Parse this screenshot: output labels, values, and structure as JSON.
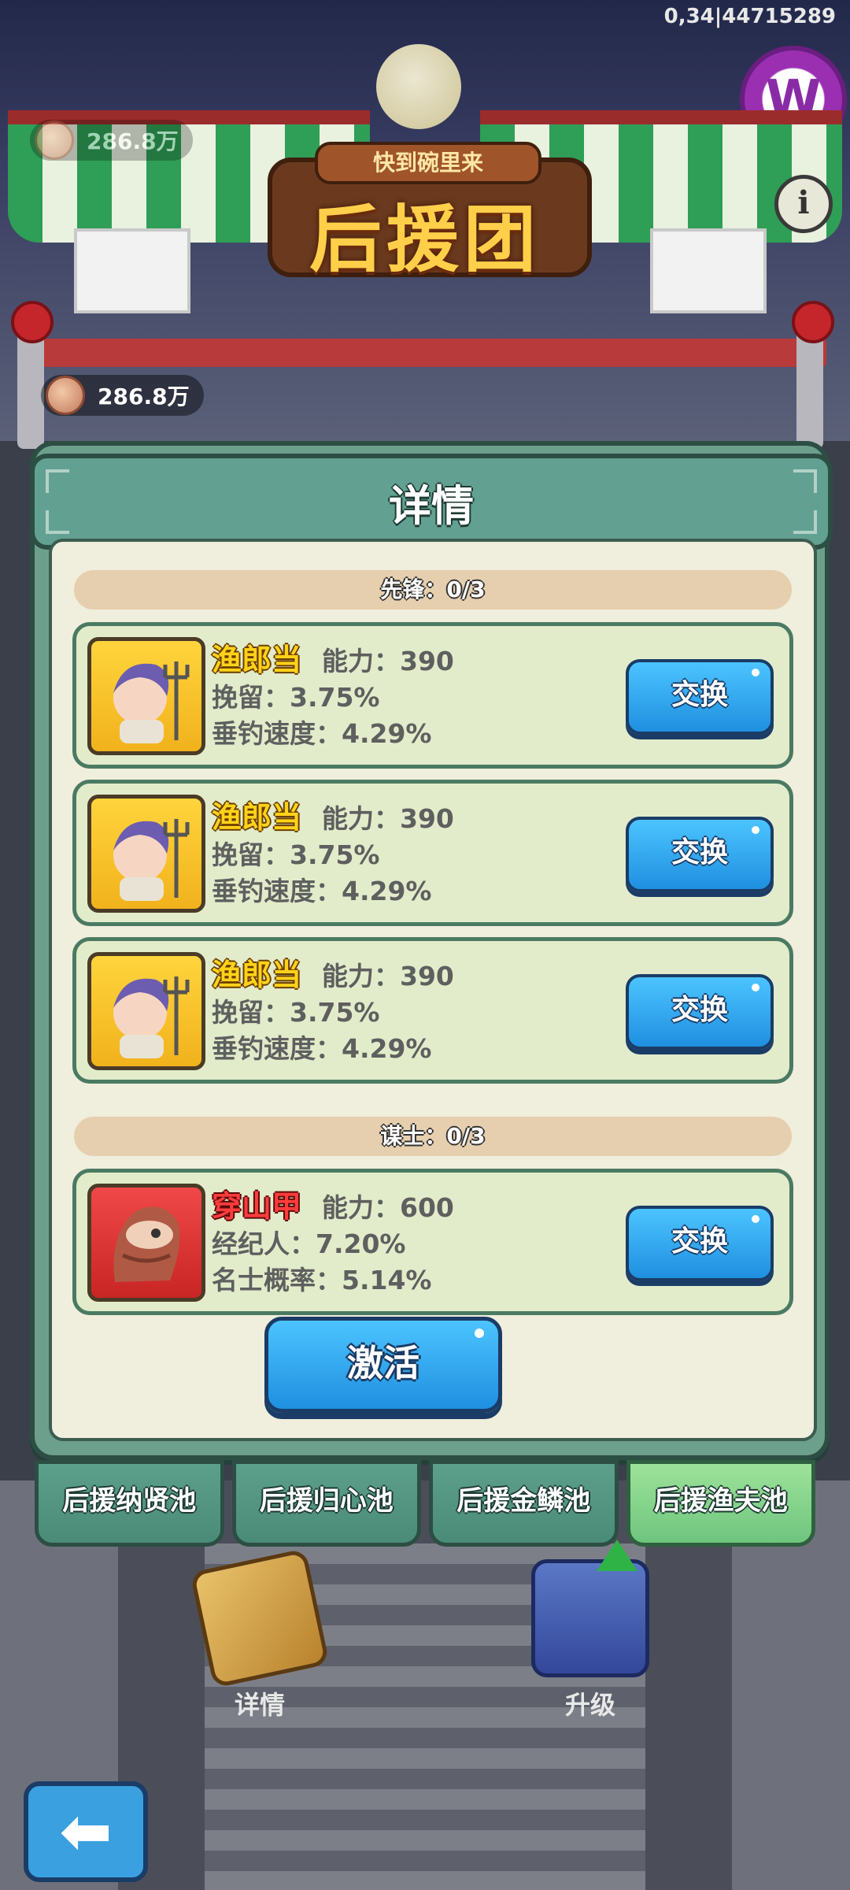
{
  "status": {
    "id_text": "0,34|44715289"
  },
  "currency": {
    "top_amount": "286.8万",
    "amount": "286.8万"
  },
  "banner": {
    "subtitle": "快到碗里来",
    "title": "后援团"
  },
  "panel": {
    "title": "详情",
    "sections": [
      {
        "label": "先锋：0/3"
      },
      {
        "label": "谋士：0/3"
      }
    ],
    "cards": [
      {
        "name": "渔郎当",
        "power": "能力：390",
        "line1": "挽留：3.75%",
        "line2": "垂钓速度：4.29%",
        "button": "交换",
        "rarity": "gold"
      },
      {
        "name": "渔郎当",
        "power": "能力：390",
        "line1": "挽留：3.75%",
        "line2": "垂钓速度：4.29%",
        "button": "交换",
        "rarity": "gold"
      },
      {
        "name": "渔郎当",
        "power": "能力：390",
        "line1": "挽留：3.75%",
        "line2": "垂钓速度：4.29%",
        "button": "交换",
        "rarity": "gold"
      },
      {
        "name": "穿山甲",
        "power": "能力：600",
        "line1": "经纪人：7.20%",
        "line2": "名士概率：5.14%",
        "button": "交换",
        "rarity": "red"
      }
    ],
    "activate_label": "激活"
  },
  "tabs": [
    {
      "label": "后援纳贤池",
      "active": false
    },
    {
      "label": "后援归心池",
      "active": false
    },
    {
      "label": "后援金鳞池",
      "active": false
    },
    {
      "label": "后援渔夫池",
      "active": true
    }
  ],
  "bottom": {
    "details_label": "详情",
    "upgrade_label": "升级"
  },
  "icons": {
    "back": "back-arrow-icon",
    "info": "info-icon",
    "logo": "w-logo-icon"
  },
  "colors": {
    "accent_blue": "#2aa7f0",
    "panel_green": "#6d9f8d",
    "active_tab": "#8fd98f",
    "gold_card": "#ffd43c",
    "red_card": "#e23a3a"
  }
}
